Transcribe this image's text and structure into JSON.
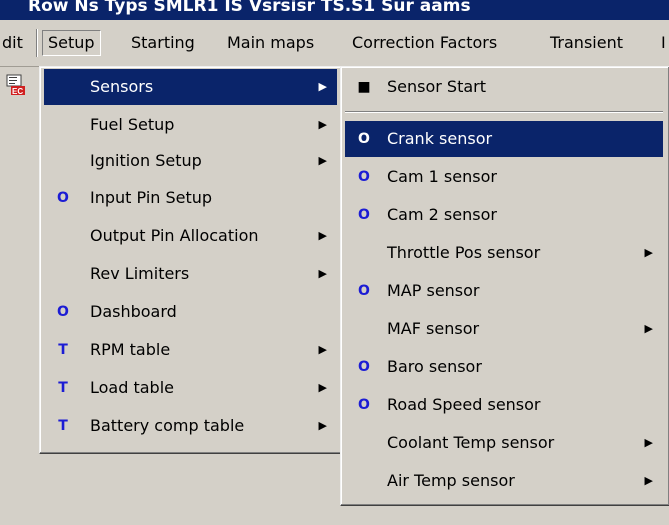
{
  "title": {
    "text": "Row Ns   Typs  SMLR1 IS  Vsrsisr  TS.S1  Sur aams"
  },
  "menubar": [
    {
      "label": "dit"
    },
    {
      "label": "Setup"
    },
    {
      "label": "Starting"
    },
    {
      "label": "Main maps"
    },
    {
      "label": "Correction Factors"
    },
    {
      "label": "Transient"
    },
    {
      "label": "I"
    }
  ],
  "setup_menu": [
    {
      "label": "Sensors",
      "icon": "",
      "arrow": "▶",
      "selected": true
    },
    {
      "label": "Fuel Setup",
      "icon": "",
      "arrow": "▶"
    },
    {
      "label": "Ignition Setup",
      "icon": "",
      "arrow": "▶"
    },
    {
      "label": "Input Pin Setup",
      "icon": "O",
      "arrow": ""
    },
    {
      "label": "Output Pin Allocation",
      "icon": "",
      "arrow": "▶"
    },
    {
      "label": "Rev Limiters",
      "icon": "",
      "arrow": "▶"
    },
    {
      "label": "Dashboard",
      "icon": "O",
      "arrow": ""
    },
    {
      "label": "RPM table",
      "icon": "T",
      "arrow": "▶"
    },
    {
      "label": "Load table",
      "icon": "T",
      "arrow": "▶"
    },
    {
      "label": "Battery comp table",
      "icon": "T",
      "arrow": "▶"
    }
  ],
  "sensors_menu": [
    {
      "label": "Sensor Start",
      "icon": "■",
      "arrow": ""
    },
    {
      "label": "Crank sensor",
      "icon": "O",
      "arrow": "",
      "selected": true
    },
    {
      "label": "Cam 1 sensor",
      "icon": "O",
      "arrow": ""
    },
    {
      "label": "Cam 2 sensor",
      "icon": "O",
      "arrow": ""
    },
    {
      "label": "Throttle Pos sensor",
      "icon": "",
      "arrow": "▶"
    },
    {
      "label": "MAP sensor",
      "icon": "O",
      "arrow": ""
    },
    {
      "label": "MAF sensor",
      "icon": "",
      "arrow": "▶"
    },
    {
      "label": "Baro sensor",
      "icon": "O",
      "arrow": ""
    },
    {
      "label": "Road Speed sensor",
      "icon": "O",
      "arrow": ""
    },
    {
      "label": "Coolant Temp sensor",
      "icon": "",
      "arrow": "▶"
    },
    {
      "label": "Air Temp sensor",
      "icon": "",
      "arrow": "▶"
    }
  ],
  "colors": {
    "highlight": "#0a246a",
    "face": "#d4d0c8",
    "icon_blue": "#1c1cd4"
  }
}
